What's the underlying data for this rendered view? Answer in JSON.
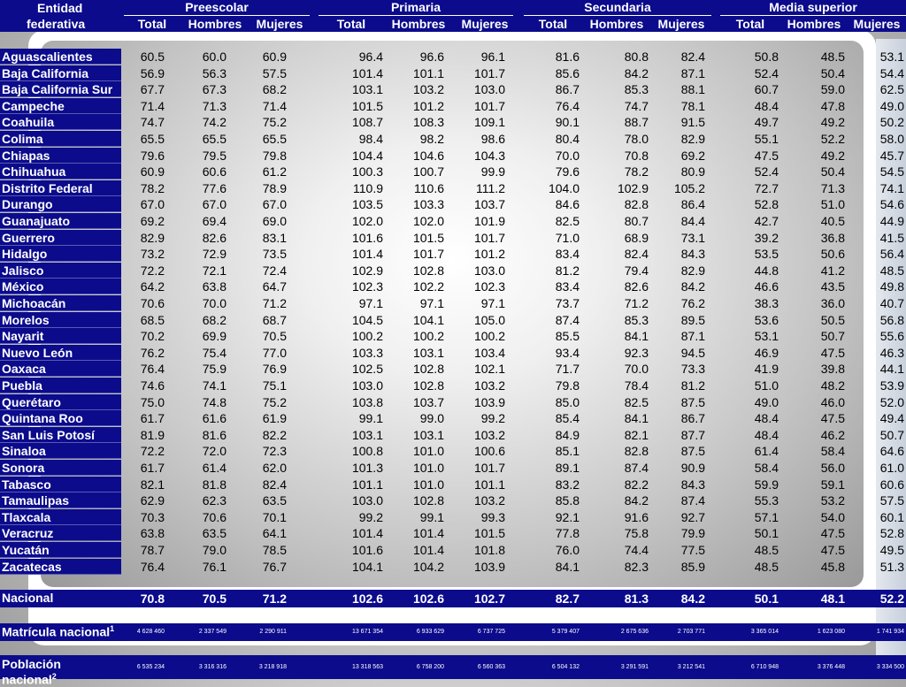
{
  "header": {
    "entity_line1": "Entidad",
    "entity_line2": "federativa",
    "groups": [
      "Preescolar",
      "Primaria",
      "Secundaria",
      "Media superior"
    ],
    "subcols": [
      "Total",
      "Hombres",
      "Mujeres"
    ]
  },
  "rows": [
    {
      "name": "Aguascalientes",
      "vals": [
        "60.5",
        "60.0",
        "60.9",
        "96.4",
        "96.6",
        "96.1",
        "81.6",
        "80.8",
        "82.4",
        "50.8",
        "48.5",
        "53.1"
      ]
    },
    {
      "name": "Baja California",
      "vals": [
        "56.9",
        "56.3",
        "57.5",
        "101.4",
        "101.1",
        "101.7",
        "85.6",
        "84.2",
        "87.1",
        "52.4",
        "50.4",
        "54.4"
      ]
    },
    {
      "name": "Baja California Sur",
      "vals": [
        "67.7",
        "67.3",
        "68.2",
        "103.1",
        "103.2",
        "103.0",
        "86.7",
        "85.3",
        "88.1",
        "60.7",
        "59.0",
        "62.5"
      ]
    },
    {
      "name": "Campeche",
      "vals": [
        "71.4",
        "71.3",
        "71.4",
        "101.5",
        "101.2",
        "101.7",
        "76.4",
        "74.7",
        "78.1",
        "48.4",
        "47.8",
        "49.0"
      ]
    },
    {
      "name": "Coahuila",
      "vals": [
        "74.7",
        "74.2",
        "75.2",
        "108.7",
        "108.3",
        "109.1",
        "90.1",
        "88.7",
        "91.5",
        "49.7",
        "49.2",
        "50.2"
      ]
    },
    {
      "name": "Colima",
      "vals": [
        "65.5",
        "65.5",
        "65.5",
        "98.4",
        "98.2",
        "98.6",
        "80.4",
        "78.0",
        "82.9",
        "55.1",
        "52.2",
        "58.0"
      ]
    },
    {
      "name": "Chiapas",
      "vals": [
        "79.6",
        "79.5",
        "79.8",
        "104.4",
        "104.6",
        "104.3",
        "70.0",
        "70.8",
        "69.2",
        "47.5",
        "49.2",
        "45.7"
      ]
    },
    {
      "name": "Chihuahua",
      "vals": [
        "60.9",
        "60.6",
        "61.2",
        "100.3",
        "100.7",
        "99.9",
        "79.6",
        "78.2",
        "80.9",
        "52.4",
        "50.4",
        "54.5"
      ]
    },
    {
      "name": "Distrito Federal",
      "vals": [
        "78.2",
        "77.6",
        "78.9",
        "110.9",
        "110.6",
        "111.2",
        "104.0",
        "102.9",
        "105.2",
        "72.7",
        "71.3",
        "74.1"
      ]
    },
    {
      "name": "Durango",
      "vals": [
        "67.0",
        "67.0",
        "67.0",
        "103.5",
        "103.3",
        "103.7",
        "84.6",
        "82.8",
        "86.4",
        "52.8",
        "51.0",
        "54.6"
      ]
    },
    {
      "name": "Guanajuato",
      "vals": [
        "69.2",
        "69.4",
        "69.0",
        "102.0",
        "102.0",
        "101.9",
        "82.5",
        "80.7",
        "84.4",
        "42.7",
        "40.5",
        "44.9"
      ]
    },
    {
      "name": "Guerrero",
      "vals": [
        "82.9",
        "82.6",
        "83.1",
        "101.6",
        "101.5",
        "101.7",
        "71.0",
        "68.9",
        "73.1",
        "39.2",
        "36.8",
        "41.5"
      ]
    },
    {
      "name": "Hidalgo",
      "vals": [
        "73.2",
        "72.9",
        "73.5",
        "101.4",
        "101.7",
        "101.2",
        "83.4",
        "82.4",
        "84.3",
        "53.5",
        "50.6",
        "56.4"
      ]
    },
    {
      "name": "Jalisco",
      "vals": [
        "72.2",
        "72.1",
        "72.4",
        "102.9",
        "102.8",
        "103.0",
        "81.2",
        "79.4",
        "82.9",
        "44.8",
        "41.2",
        "48.5"
      ]
    },
    {
      "name": "México",
      "vals": [
        "64.2",
        "63.8",
        "64.7",
        "102.3",
        "102.2",
        "102.3",
        "83.4",
        "82.6",
        "84.2",
        "46.6",
        "43.5",
        "49.8"
      ]
    },
    {
      "name": "Michoacán",
      "vals": [
        "70.6",
        "70.0",
        "71.2",
        "97.1",
        "97.1",
        "97.1",
        "73.7",
        "71.2",
        "76.2",
        "38.3",
        "36.0",
        "40.7"
      ]
    },
    {
      "name": "Morelos",
      "vals": [
        "68.5",
        "68.2",
        "68.7",
        "104.5",
        "104.1",
        "105.0",
        "87.4",
        "85.3",
        "89.5",
        "53.6",
        "50.5",
        "56.8"
      ]
    },
    {
      "name": "Nayarit",
      "vals": [
        "70.2",
        "69.9",
        "70.5",
        "100.2",
        "100.2",
        "100.2",
        "85.5",
        "84.1",
        "87.1",
        "53.1",
        "50.7",
        "55.6"
      ]
    },
    {
      "name": "Nuevo León",
      "vals": [
        "76.2",
        "75.4",
        "77.0",
        "103.3",
        "103.1",
        "103.4",
        "93.4",
        "92.3",
        "94.5",
        "46.9",
        "47.5",
        "46.3"
      ]
    },
    {
      "name": "Oaxaca",
      "vals": [
        "76.4",
        "75.9",
        "76.9",
        "102.5",
        "102.8",
        "102.1",
        "71.7",
        "70.0",
        "73.3",
        "41.9",
        "39.8",
        "44.1"
      ]
    },
    {
      "name": "Puebla",
      "vals": [
        "74.6",
        "74.1",
        "75.1",
        "103.0",
        "102.8",
        "103.2",
        "79.8",
        "78.4",
        "81.2",
        "51.0",
        "48.2",
        "53.9"
      ]
    },
    {
      "name": "Querétaro",
      "vals": [
        "75.0",
        "74.8",
        "75.2",
        "103.8",
        "103.7",
        "103.9",
        "85.0",
        "82.5",
        "87.5",
        "49.0",
        "46.0",
        "52.0"
      ]
    },
    {
      "name": "Quintana Roo",
      "vals": [
        "61.7",
        "61.6",
        "61.9",
        "99.1",
        "99.0",
        "99.2",
        "85.4",
        "84.1",
        "86.7",
        "48.4",
        "47.5",
        "49.4"
      ]
    },
    {
      "name": "San Luis Potosí",
      "vals": [
        "81.9",
        "81.6",
        "82.2",
        "103.1",
        "103.1",
        "103.2",
        "84.9",
        "82.1",
        "87.7",
        "48.4",
        "46.2",
        "50.7"
      ]
    },
    {
      "name": "Sinaloa",
      "vals": [
        "72.2",
        "72.0",
        "72.3",
        "100.8",
        "101.0",
        "100.6",
        "85.1",
        "82.8",
        "87.5",
        "61.4",
        "58.4",
        "64.6"
      ]
    },
    {
      "name": "Sonora",
      "vals": [
        "61.7",
        "61.4",
        "62.0",
        "101.3",
        "101.0",
        "101.7",
        "89.1",
        "87.4",
        "90.9",
        "58.4",
        "56.0",
        "61.0"
      ]
    },
    {
      "name": "Tabasco",
      "vals": [
        "82.1",
        "81.8",
        "82.4",
        "101.1",
        "101.0",
        "101.1",
        "83.2",
        "82.2",
        "84.3",
        "59.9",
        "59.1",
        "60.6"
      ]
    },
    {
      "name": "Tamaulipas",
      "vals": [
        "62.9",
        "62.3",
        "63.5",
        "103.0",
        "102.8",
        "103.2",
        "85.8",
        "84.2",
        "87.4",
        "55.3",
        "53.2",
        "57.5"
      ]
    },
    {
      "name": "Tlaxcala",
      "vals": [
        "70.3",
        "70.6",
        "70.1",
        "99.2",
        "99.1",
        "99.3",
        "92.1",
        "91.6",
        "92.7",
        "57.1",
        "54.0",
        "60.1"
      ]
    },
    {
      "name": "Veracruz",
      "vals": [
        "63.8",
        "63.5",
        "64.1",
        "101.4",
        "101.4",
        "101.5",
        "77.8",
        "75.8",
        "79.9",
        "50.1",
        "47.5",
        "52.8"
      ]
    },
    {
      "name": "Yucatán",
      "vals": [
        "78.7",
        "79.0",
        "78.5",
        "101.6",
        "101.4",
        "101.8",
        "76.0",
        "74.4",
        "77.5",
        "48.5",
        "47.5",
        "49.5"
      ]
    },
    {
      "name": "Zacatecas",
      "vals": [
        "76.4",
        "76.1",
        "76.7",
        "104.1",
        "104.2",
        "103.9",
        "84.1",
        "82.3",
        "85.9",
        "48.5",
        "45.8",
        "51.3"
      ]
    }
  ],
  "nacional": {
    "name": "Nacional",
    "vals": [
      "70.8",
      "70.5",
      "71.2",
      "102.6",
      "102.6",
      "102.7",
      "82.7",
      "81.3",
      "84.2",
      "50.1",
      "48.1",
      "52.2"
    ]
  },
  "matricula": {
    "name": "Matrícula nacional",
    "sup": "1",
    "vals": [
      "4 628 460",
      "2 337 549",
      "2 290 911",
      "13 671 354",
      "6 933 629",
      "6 737 725",
      "5 379 407",
      "2 675 636",
      "2 703 771",
      "3 365 014",
      "1 623 080",
      "1 741 934"
    ]
  },
  "poblacion": {
    "name_line1": "Población",
    "name_line2": "nacional",
    "sup": "2",
    "vals": [
      "6 535 234",
      "3 316 316",
      "3 218 918",
      "13 318 563",
      "6 758 200",
      "6 560 363",
      "6 504 132",
      "3 291 591",
      "3 212 541",
      "6 710 948",
      "3 376 448",
      "3 334 500"
    ]
  }
}
